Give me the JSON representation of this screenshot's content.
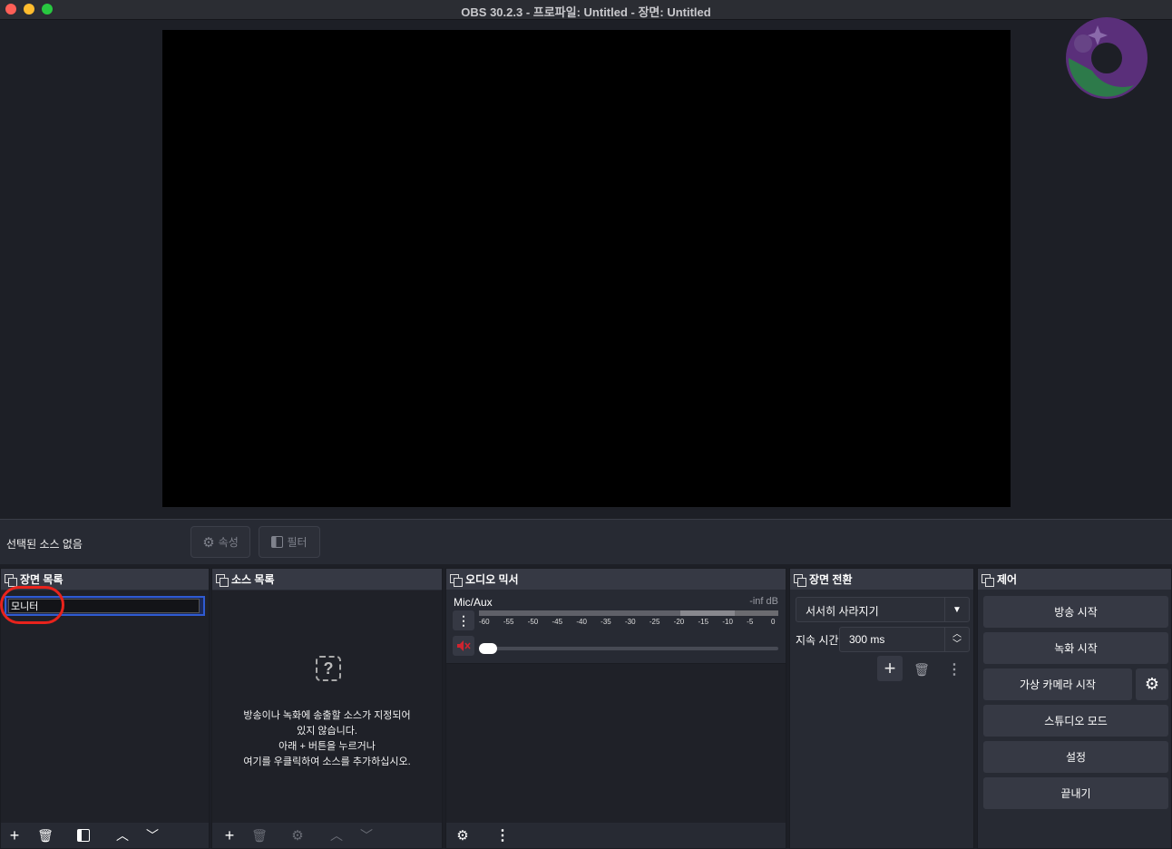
{
  "window": {
    "title": "OBS 30.2.3 - 프로파일: Untitled - 장면: Untitled"
  },
  "source_bar": {
    "label": "선택된 소스 없음",
    "properties_label": "속성",
    "filters_label": "필터"
  },
  "scenes": {
    "title": "장면 목록",
    "items": [
      "모니터"
    ]
  },
  "sources": {
    "title": "소스 목록",
    "empty_message_lines": [
      "방송이나 녹화에 송출할 소스가 지정되어",
      "있지 않습니다.",
      "아래 + 버튼을 누르거나",
      "여기를 우클릭하여 소스를 추가하십시오."
    ]
  },
  "mixer": {
    "title": "오디오 믹서",
    "channel_name": "Mic/Aux",
    "level_text": "-inf dB",
    "ticks": [
      "-60",
      "-55",
      "-50",
      "-45",
      "-40",
      "-35",
      "-30",
      "-25",
      "-20",
      "-15",
      "-10",
      "-5",
      "0"
    ],
    "muted": true
  },
  "transitions": {
    "title": "장면 전환",
    "selected": "서서히 사라지기",
    "duration_label": "지속 시간",
    "duration_value": "300 ms"
  },
  "controls": {
    "title": "제어",
    "buttons": [
      "방송 시작",
      "녹화 시작",
      "가상 카메라 시작",
      "스튜디오 모드",
      "설정",
      "끝내기"
    ]
  },
  "colors": {
    "accent": "#2f5bd2",
    "annotation": "#e8231c",
    "muted": "#d1242f"
  }
}
